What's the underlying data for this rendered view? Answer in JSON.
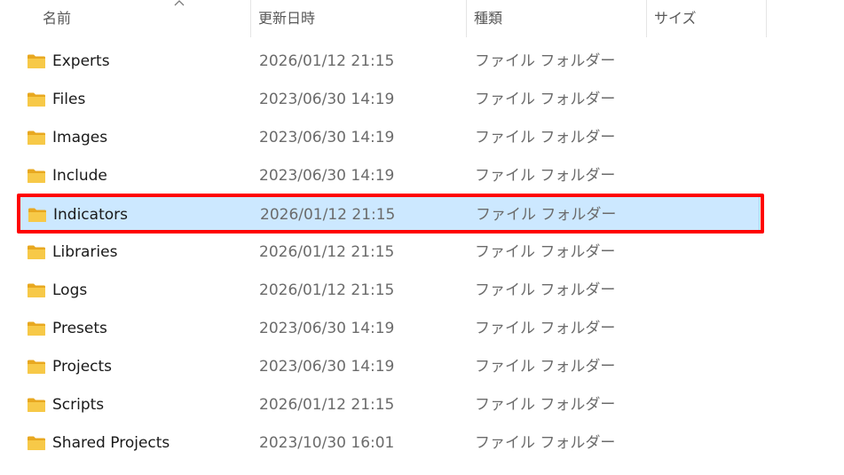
{
  "columns": {
    "name": "名前",
    "date": "更新日時",
    "type": "種類",
    "size": "サイズ"
  },
  "sort": {
    "column": "name",
    "direction": "ascending"
  },
  "colors": {
    "selection": "#cce8ff",
    "highlight_border": "#ff0000",
    "folder_icon": "#f7c948"
  },
  "rows": [
    {
      "name": "Experts",
      "date": "2026/01/12 21:15",
      "type": "ファイル フォルダー",
      "icon": "folder-icon"
    },
    {
      "name": "Files",
      "date": "2023/06/30 14:19",
      "type": "ファイル フォルダー",
      "icon": "folder-icon"
    },
    {
      "name": "Images",
      "date": "2023/06/30 14:19",
      "type": "ファイル フォルダー",
      "icon": "folder-icon"
    },
    {
      "name": "Include",
      "date": "2023/06/30 14:19",
      "type": "ファイル フォルダー",
      "icon": "folder-icon"
    },
    {
      "name": "Indicators",
      "date": "2026/01/12 21:15",
      "type": "ファイル フォルダー",
      "icon": "folder-icon",
      "selected": true
    },
    {
      "name": "Libraries",
      "date": "2026/01/12 21:15",
      "type": "ファイル フォルダー",
      "icon": "folder-icon"
    },
    {
      "name": "Logs",
      "date": "2026/01/12 21:15",
      "type": "ファイル フォルダー",
      "icon": "folder-icon"
    },
    {
      "name": "Presets",
      "date": "2023/06/30 14:19",
      "type": "ファイル フォルダー",
      "icon": "folder-icon"
    },
    {
      "name": "Projects",
      "date": "2023/06/30 14:19",
      "type": "ファイル フォルダー",
      "icon": "folder-icon"
    },
    {
      "name": "Scripts",
      "date": "2026/01/12 21:15",
      "type": "ファイル フォルダー",
      "icon": "folder-icon"
    },
    {
      "name": "Shared Projects",
      "date": "2023/10/30 16:01",
      "type": "ファイル フォルダー",
      "icon": "folder-icon"
    }
  ]
}
